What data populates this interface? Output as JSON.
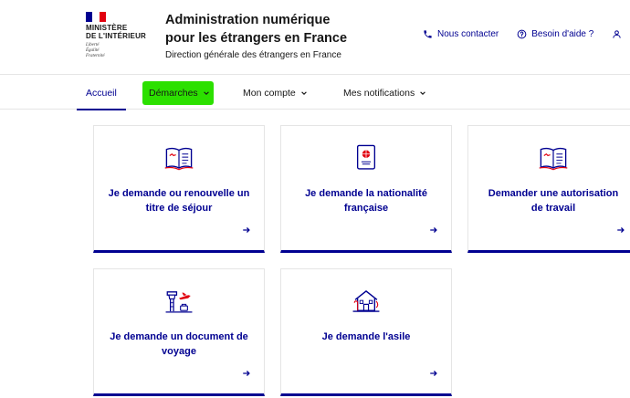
{
  "header": {
    "ministry_lines": [
      "MINISTÈRE",
      "DE L'INTÉRIEUR"
    ],
    "motto_lines": [
      "Liberté",
      "Égalité",
      "Fraternité"
    ],
    "title_line1": "Administration numérique",
    "title_line2": "pour les étrangers en France",
    "subtitle": "Direction générale des étrangers en France",
    "tools": [
      {
        "label": "Nous contacter",
        "icon": "phone-icon"
      },
      {
        "label": "Besoin d'aide ?",
        "icon": "question-circle-icon"
      }
    ]
  },
  "nav": {
    "items": [
      {
        "label": "Accueil",
        "active": true
      },
      {
        "label": "Démarches",
        "highlighted": true,
        "has_dropdown": true
      },
      {
        "label": "Mon compte",
        "has_dropdown": true
      },
      {
        "label": "Mes notifications",
        "has_dropdown": true
      }
    ]
  },
  "cards": [
    {
      "line1": "Je demande ou renouvelle un",
      "line2": "titre de séjour",
      "icon": "open-book-icon"
    },
    {
      "line1": "Je demande la nationalité",
      "line2": "française",
      "icon": "passport-icon"
    },
    {
      "line1": "Demander une autorisation",
      "line2": "de travail",
      "icon": "open-book-icon"
    },
    {
      "line1": "Je demande un document de",
      "line2": "voyage",
      "icon": "airport-tower-plane-icon"
    },
    {
      "line1": "Je demande l'asile",
      "line2": "",
      "icon": "house-shelter-icon"
    }
  ],
  "colors": {
    "primary": "#000091",
    "accent_red": "#e1000f",
    "highlight_green": "#2ce000",
    "border": "#e5e5e5"
  }
}
